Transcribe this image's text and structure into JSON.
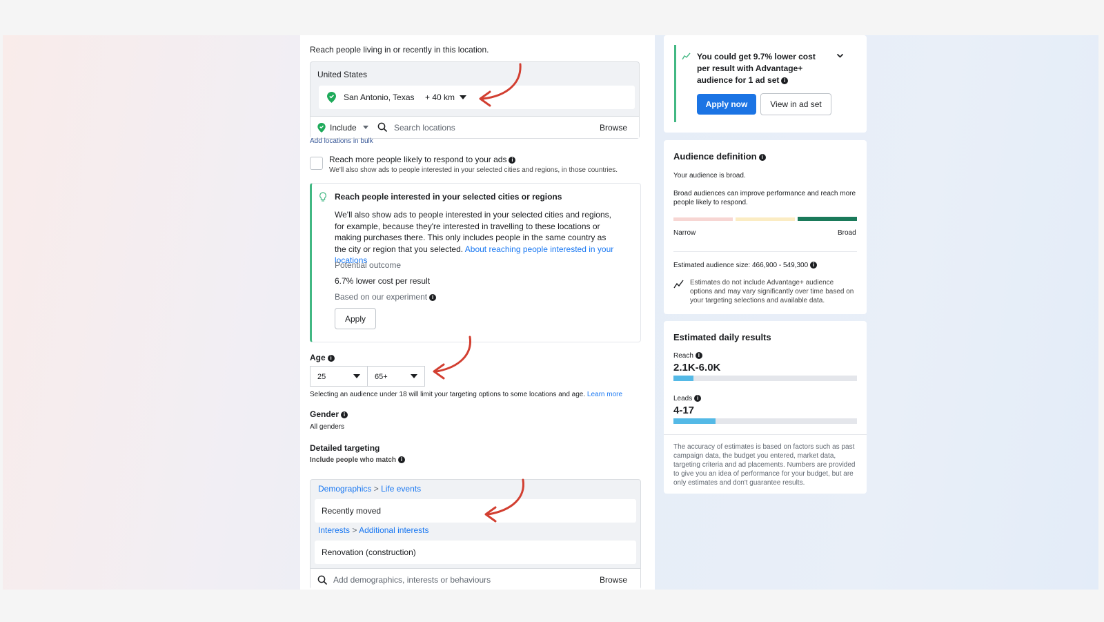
{
  "locations": {
    "description": "Reach people living in or recently in this location.",
    "country": "United States",
    "city": "San Antonio, Texas",
    "radius": "+ 40 km",
    "include_label": "Include",
    "search_placeholder": "Search locations",
    "browse_label": "Browse",
    "bulk_link": "Add locations in bulk",
    "reach_more_label": "Reach more people likely to respond to your ads",
    "reach_more_sub": "We'll also show ads to people interested in your selected cities and regions, in those countries."
  },
  "suggestion": {
    "title": "Reach people interested in your selected cities or regions",
    "body": "We'll also show ads to people interested in your selected cities and regions, for example, because they're interested in travelling to these locations or making purchases there. This only includes people in the same country as the city or region that you selected.",
    "link": "About reaching people interested in your locations",
    "potential_label": "Potential outcome",
    "outcome_pct": "6.7%",
    "outcome_text": "lower cost per result",
    "experiment": "Based on our experiment",
    "apply_label": "Apply"
  },
  "age": {
    "label": "Age",
    "min": "25",
    "max": "65+",
    "note": "Selecting an audience under 18 will limit your targeting options to some locations and age.",
    "learn_more": "Learn more"
  },
  "gender": {
    "label": "Gender",
    "value": "All genders"
  },
  "detailed": {
    "label": "Detailed targeting",
    "sub": "Include people who match",
    "groups": [
      {
        "crumb1": "Demographics",
        "sep": ">",
        "crumb2": "Life events",
        "item": "Recently moved"
      },
      {
        "crumb1": "Interests",
        "sep": ">",
        "crumb2": "Additional interests",
        "item": "Renovation (construction)"
      }
    ],
    "search_placeholder": "Add demographics, interests or behaviours",
    "browse_label": "Browse"
  },
  "advantage": {
    "text": "You could get 9.7% lower cost per result with Advantage+ audience for 1 ad set",
    "apply_now": "Apply now",
    "view_label": "View in ad set"
  },
  "audience_def": {
    "title": "Audience definition",
    "status": "Your audience is broad.",
    "desc": "Broad audiences can improve performance and reach more people likely to respond.",
    "narrow": "Narrow",
    "broad": "Broad",
    "size_label": "Estimated audience size: 466,900 - 549,300",
    "note": "Estimates do not include Advantage+ audience options and may vary significantly over time based on your targeting selections and available data.",
    "colors": {
      "narrow": "#f7d6d3",
      "mid": "#fbecc3",
      "broad": "#1a7a5a"
    }
  },
  "daily": {
    "title": "Estimated daily results",
    "reach_label": "Reach",
    "reach_value": "2.1K-6.0K",
    "reach_fill": 0.11,
    "leads_label": "Leads",
    "leads_value": "4-17",
    "leads_fill": 0.23,
    "disclaimer": "The accuracy of estimates is based on factors such as past campaign data, the budget you entered, market data, targeting criteria and ad placements. Numbers are provided to give you an idea of performance for your budget, but are only estimates and don't guarantee results."
  }
}
